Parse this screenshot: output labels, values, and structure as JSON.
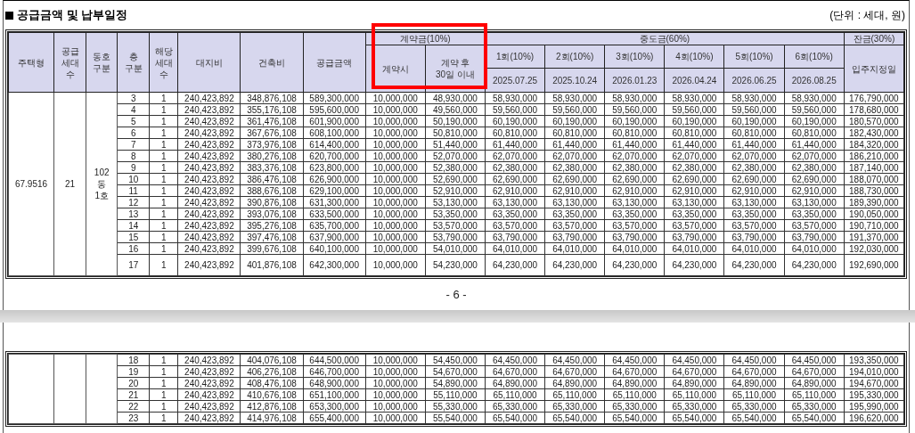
{
  "title": "공급금액 및 납부일정",
  "unit_note": "(단위 : 세대, 원)",
  "header": {
    "fixed": [
      "주택형",
      "공급\n세대\n수",
      "동호\n구분",
      "층\n구분",
      "해당\n세대\n수",
      "대지비",
      "건축비",
      "공급금액"
    ],
    "deposit": {
      "label": "계약금(10%)",
      "columns": [
        "계약시",
        "계약 후\n30일 이내"
      ]
    },
    "middle": {
      "label": "중도금(60%)",
      "columns": [
        {
          "label": "1회(10%)",
          "date": "2025.07.25"
        },
        {
          "label": "2회(10%)",
          "date": "2025.10.24"
        },
        {
          "label": "3회(10%)",
          "date": "2026.01.23"
        },
        {
          "label": "4회(10%)",
          "date": "2026.04.24"
        },
        {
          "label": "5회(10%)",
          "date": "2026.06.25"
        },
        {
          "label": "6회(10%)",
          "date": "2026.08.25"
        }
      ]
    },
    "balance": {
      "label": "잔금(30%)",
      "column": "입주지정일"
    }
  },
  "pages": [
    {
      "group": [
        "67.9516",
        "21",
        "102\n동\n1호"
      ],
      "rows": [
        [
          "3",
          "1",
          "240,423,892",
          "348,876,108",
          "589,300,000",
          "10,000,000",
          "48,930,000",
          "58,930,000",
          "58,930,000",
          "58,930,000",
          "58,930,000",
          "58,930,000",
          "58,930,000",
          "176,790,000"
        ],
        [
          "4",
          "1",
          "240,423,892",
          "355,176,108",
          "595,600,000",
          "10,000,000",
          "49,560,000",
          "59,560,000",
          "59,560,000",
          "59,560,000",
          "59,560,000",
          "59,560,000",
          "59,560,000",
          "178,680,000"
        ],
        [
          "5",
          "1",
          "240,423,892",
          "361,476,108",
          "601,900,000",
          "10,000,000",
          "50,190,000",
          "60,190,000",
          "60,190,000",
          "60,190,000",
          "60,190,000",
          "60,190,000",
          "60,190,000",
          "180,570,000"
        ],
        [
          "6",
          "1",
          "240,423,892",
          "367,676,108",
          "608,100,000",
          "10,000,000",
          "50,810,000",
          "60,810,000",
          "60,810,000",
          "60,810,000",
          "60,810,000",
          "60,810,000",
          "60,810,000",
          "182,430,000"
        ],
        [
          "7",
          "1",
          "240,423,892",
          "373,976,108",
          "614,400,000",
          "10,000,000",
          "51,440,000",
          "61,440,000",
          "61,440,000",
          "61,440,000",
          "61,440,000",
          "61,440,000",
          "61,440,000",
          "184,320,000"
        ],
        [
          "8",
          "1",
          "240,423,892",
          "380,276,108",
          "620,700,000",
          "10,000,000",
          "52,070,000",
          "62,070,000",
          "62,070,000",
          "62,070,000",
          "62,070,000",
          "62,070,000",
          "62,070,000",
          "186,210,000"
        ],
        [
          "9",
          "1",
          "240,423,892",
          "383,376,108",
          "623,800,000",
          "10,000,000",
          "52,380,000",
          "62,380,000",
          "62,380,000",
          "62,380,000",
          "62,380,000",
          "62,380,000",
          "62,380,000",
          "187,140,000"
        ],
        [
          "10",
          "1",
          "240,423,892",
          "386,476,108",
          "626,900,000",
          "10,000,000",
          "52,690,000",
          "62,690,000",
          "62,690,000",
          "62,690,000",
          "62,690,000",
          "62,690,000",
          "62,690,000",
          "188,070,000"
        ],
        [
          "11",
          "1",
          "240,423,892",
          "388,676,108",
          "629,100,000",
          "10,000,000",
          "52,910,000",
          "62,910,000",
          "62,910,000",
          "62,910,000",
          "62,910,000",
          "62,910,000",
          "62,910,000",
          "188,730,000"
        ],
        [
          "12",
          "1",
          "240,423,892",
          "390,876,108",
          "631,300,000",
          "10,000,000",
          "53,130,000",
          "63,130,000",
          "63,130,000",
          "63,130,000",
          "63,130,000",
          "63,130,000",
          "63,130,000",
          "189,390,000"
        ],
        [
          "13",
          "1",
          "240,423,892",
          "393,076,108",
          "633,500,000",
          "10,000,000",
          "53,350,000",
          "63,350,000",
          "63,350,000",
          "63,350,000",
          "63,350,000",
          "63,350,000",
          "63,350,000",
          "190,050,000"
        ],
        [
          "14",
          "1",
          "240,423,892",
          "395,276,108",
          "635,700,000",
          "10,000,000",
          "53,570,000",
          "63,570,000",
          "63,570,000",
          "63,570,000",
          "63,570,000",
          "63,570,000",
          "63,570,000",
          "190,710,000"
        ],
        [
          "15",
          "1",
          "240,423,892",
          "397,476,108",
          "637,900,000",
          "10,000,000",
          "53,790,000",
          "63,790,000",
          "63,790,000",
          "63,790,000",
          "63,790,000",
          "63,790,000",
          "63,790,000",
          "191,370,000"
        ],
        [
          "16",
          "1",
          "240,423,892",
          "399,676,108",
          "640,100,000",
          "10,000,000",
          "54,010,000",
          "64,010,000",
          "64,010,000",
          "64,010,000",
          "64,010,000",
          "64,010,000",
          "64,010,000",
          "192,030,000"
        ],
        [
          "17",
          "1",
          "240,423,892",
          "401,876,108",
          "642,300,000",
          "10,000,000",
          "54,230,000",
          "64,230,000",
          "64,230,000",
          "64,230,000",
          "64,230,000",
          "64,230,000",
          "64,230,000",
          "192,690,000"
        ]
      ],
      "page_number": "- 6 -"
    },
    {
      "rows": [
        [
          "18",
          "1",
          "240,423,892",
          "404,076,108",
          "644,500,000",
          "10,000,000",
          "54,450,000",
          "64,450,000",
          "64,450,000",
          "64,450,000",
          "64,450,000",
          "64,450,000",
          "64,450,000",
          "193,350,000"
        ],
        [
          "19",
          "1",
          "240,423,892",
          "406,276,108",
          "646,700,000",
          "10,000,000",
          "54,670,000",
          "64,670,000",
          "64,670,000",
          "64,670,000",
          "64,670,000",
          "64,670,000",
          "64,670,000",
          "194,010,000"
        ],
        [
          "20",
          "1",
          "240,423,892",
          "408,476,108",
          "648,900,000",
          "10,000,000",
          "54,890,000",
          "64,890,000",
          "64,890,000",
          "64,890,000",
          "64,890,000",
          "64,890,000",
          "64,890,000",
          "194,670,000"
        ],
        [
          "21",
          "1",
          "240,423,892",
          "410,676,108",
          "651,100,000",
          "10,000,000",
          "55,110,000",
          "65,110,000",
          "65,110,000",
          "65,110,000",
          "65,110,000",
          "65,110,000",
          "65,110,000",
          "195,330,000"
        ],
        [
          "22",
          "1",
          "240,423,892",
          "412,876,108",
          "653,300,000",
          "10,000,000",
          "55,330,000",
          "65,330,000",
          "65,330,000",
          "65,330,000",
          "65,330,000",
          "65,330,000",
          "65,330,000",
          "195,990,000"
        ],
        [
          "23",
          "1",
          "240,423,892",
          "414,976,108",
          "655,400,000",
          "10,000,000",
          "55,540,000",
          "65,540,000",
          "65,540,000",
          "65,540,000",
          "65,540,000",
          "65,540,000",
          "65,540,000",
          "196,620,000"
        ]
      ]
    }
  ]
}
